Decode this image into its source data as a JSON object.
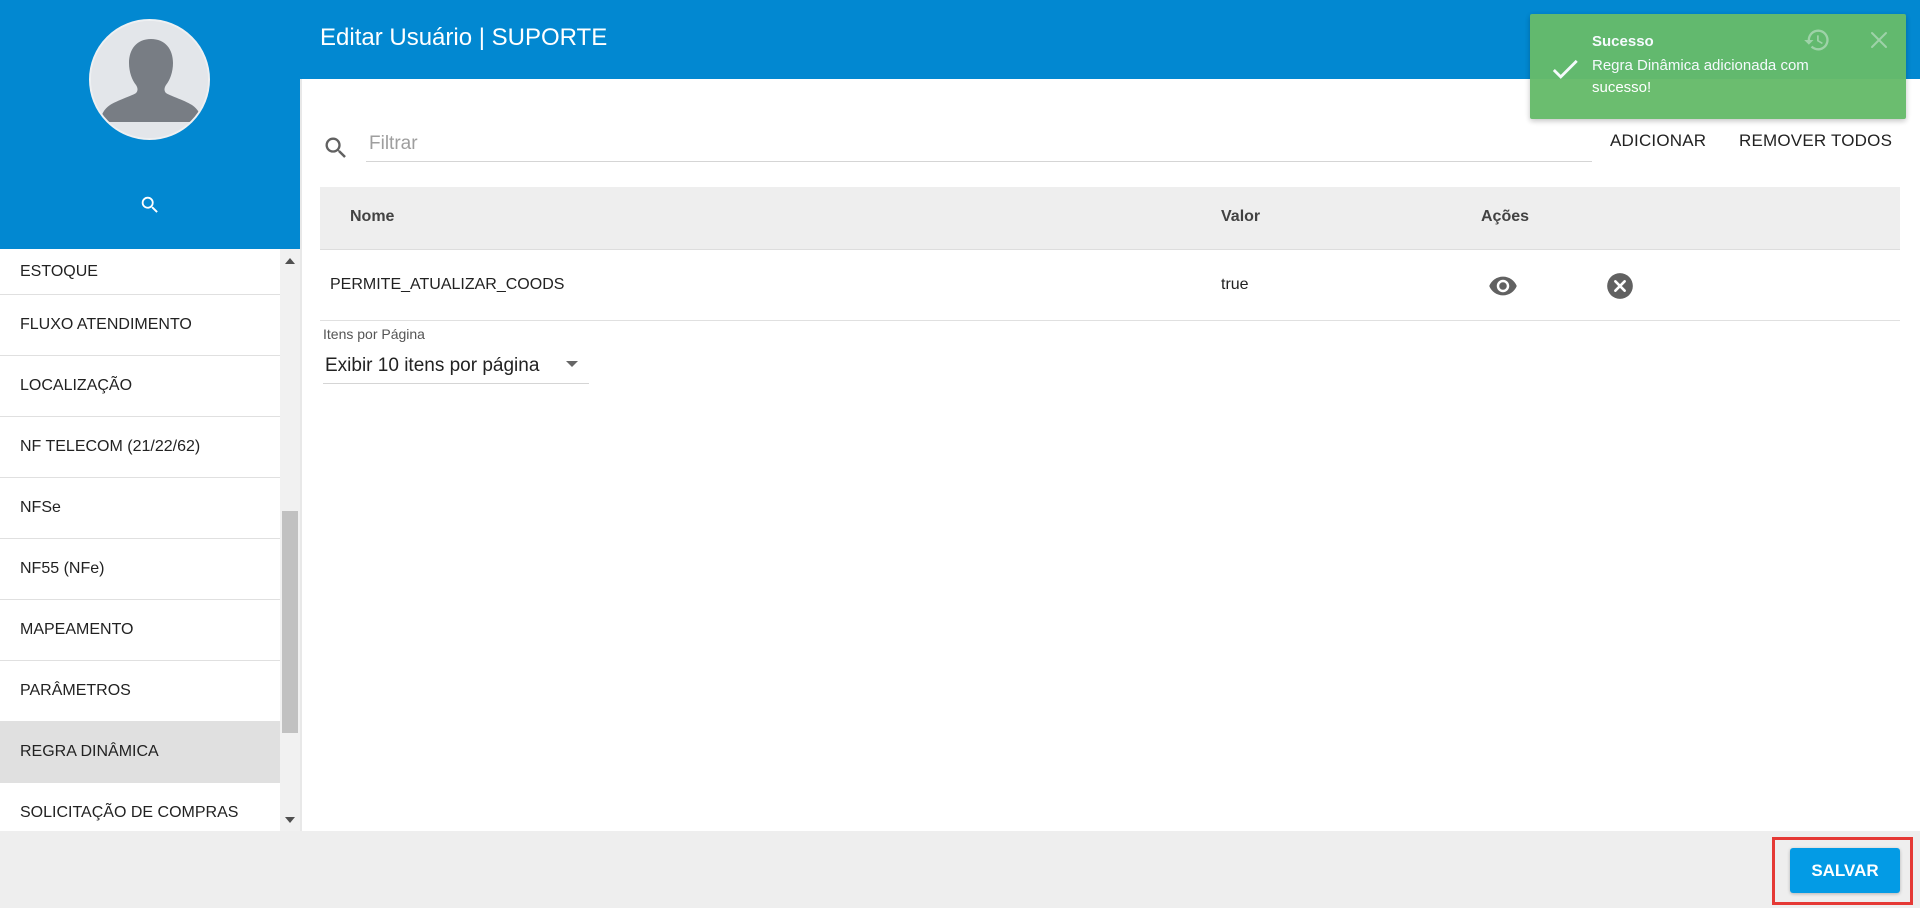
{
  "header": {
    "title": "Editar Usuário | SUPORTE"
  },
  "sidebar": {
    "items": [
      {
        "label": "ESTOQUE"
      },
      {
        "label": "FLUXO ATENDIMENTO"
      },
      {
        "label": "LOCALIZAÇÃO"
      },
      {
        "label": "NF TELECOM (21/22/62)"
      },
      {
        "label": "NFSe"
      },
      {
        "label": "NF55 (NFe)"
      },
      {
        "label": "MAPEAMENTO"
      },
      {
        "label": "PARÂMETROS"
      },
      {
        "label": "REGRA DINÂMICA",
        "active": true
      },
      {
        "label": "SOLICITAÇÃO DE COMPRAS"
      }
    ]
  },
  "filter": {
    "placeholder": "Filtrar",
    "value": ""
  },
  "toolbar": {
    "add_label": "ADICIONAR",
    "remove_all_label": "REMOVER TODOS"
  },
  "table": {
    "columns": [
      "Nome",
      "Valor",
      "Ações"
    ],
    "rows": [
      {
        "nome": "PERMITE_ATUALIZAR_COODS",
        "valor": "true"
      }
    ]
  },
  "pagination": {
    "label": "Itens por Página",
    "selected": "Exibir 10 itens por página"
  },
  "footer": {
    "save_label": "SALVAR"
  },
  "toast": {
    "title": "Sucesso",
    "message": "Regra Dinâmica adicionada com sucesso!"
  },
  "colors": {
    "primary": "#0288d1",
    "save_button": "#039be5",
    "toast_bg": "#66bb6a",
    "highlight": "#e53935",
    "active_item": "#e0e0e0"
  },
  "icons": [
    "search-icon",
    "eye-icon",
    "remove-circle-icon",
    "check-icon",
    "history-icon",
    "close-icon",
    "chevron-down-icon",
    "scroll-up-icon",
    "scroll-down-icon"
  ]
}
